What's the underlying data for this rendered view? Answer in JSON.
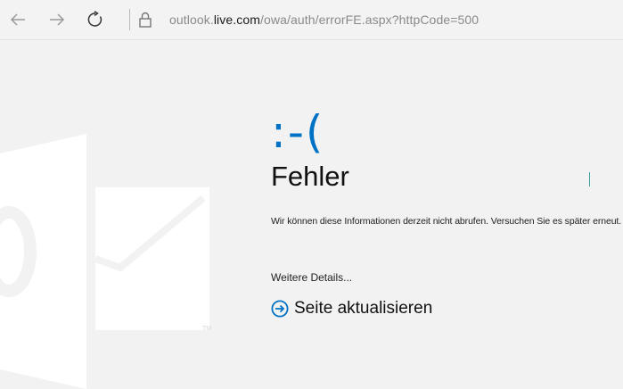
{
  "browser": {
    "address": {
      "prefix": "outlook.",
      "host": "live.com",
      "path": "/owa/auth/errorFE.aspx?httpCode=500"
    },
    "icons": [
      "back-arrow-icon",
      "forward-arrow-icon",
      "refresh-icon",
      "lock-icon"
    ]
  },
  "error": {
    "emoticon": ":-(",
    "title": "Fehler",
    "message": "Wir können diese Informationen derzeit nicht abrufen. Versuchen Sie es später erneut.",
    "details_link": "Weitere Details...",
    "refresh_label": "Seite aktualisieren"
  },
  "colors": {
    "accent": "#0072c6",
    "background": "#f2f2f2",
    "logo": "#ffffff"
  }
}
